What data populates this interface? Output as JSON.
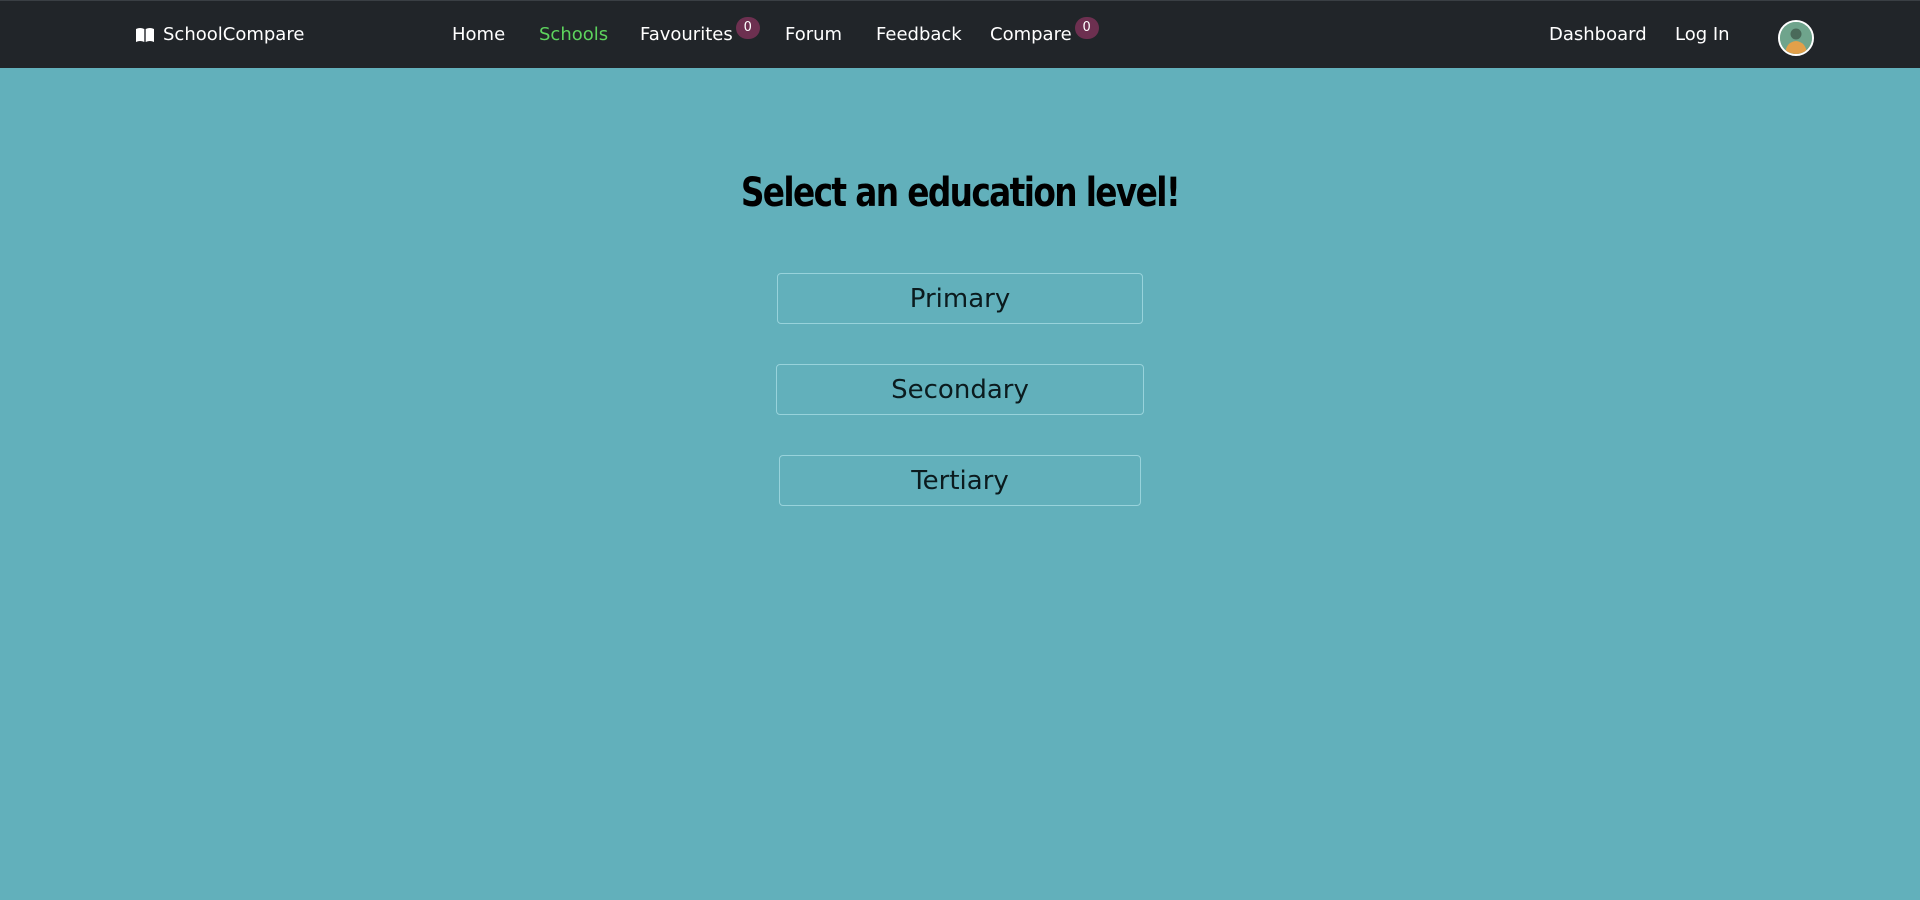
{
  "navbar": {
    "brand": "SchoolCompare",
    "brand_icon": "open-book-icon",
    "links": {
      "home": "Home",
      "schools": "Schools",
      "favourites": "Favourites",
      "favourites_count": "0",
      "forum": "Forum",
      "feedback": "Feedback",
      "compare": "Compare",
      "compare_count": "0",
      "dashboard": "Dashboard",
      "login": "Log In"
    },
    "active_link": "Schools",
    "avatar_icon": "user-avatar-icon"
  },
  "main": {
    "heading": "Select an education level!",
    "levels": [
      "Primary",
      "Secondary",
      "Tertiary"
    ]
  },
  "colors": {
    "page_background": "#62b0bb",
    "navbar_background": "#212529",
    "active_link": "#5dd35d",
    "badge": "#6d3050",
    "button_border": "#98d3db"
  }
}
